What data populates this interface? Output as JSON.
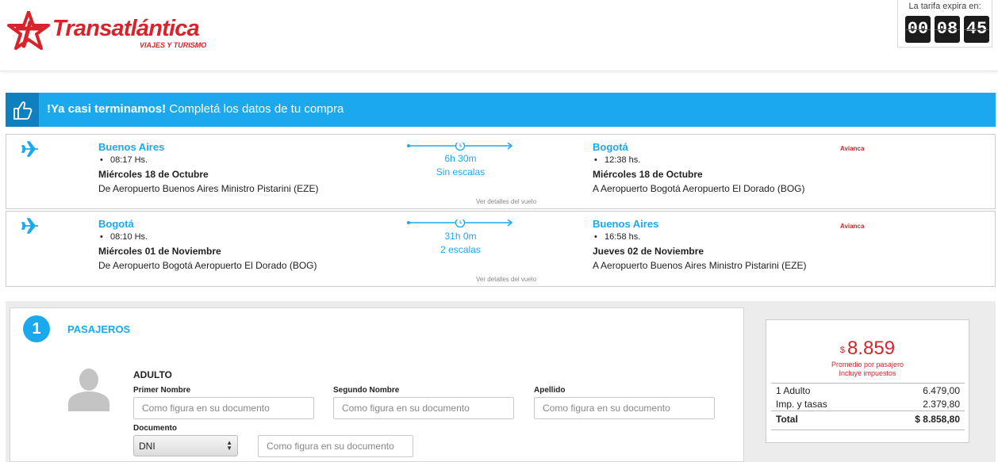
{
  "brand": {
    "name": "Transatlántica",
    "tagline": "VIAJES Y TURISMO"
  },
  "timer": {
    "label": "La tarifa expira en:",
    "hours": "00",
    "minutes": "08",
    "seconds": "45"
  },
  "banner": {
    "bold": "!Ya casi terminamos!",
    "text": "Completá los datos de tu compra"
  },
  "flights": [
    {
      "origin": {
        "city": "Buenos Aires",
        "time": "08:17 Hs.",
        "date": "Miércoles 18 de Octubre",
        "airport": "De Aeropuerto Buenos Aires Ministro Pistarini (EZE)"
      },
      "duration": "6h 30m",
      "stops": "Sin escalas",
      "destination": {
        "city": "Bogotá",
        "time": "12:38 hs.",
        "date": "Miércoles 18 de Octubre",
        "airport": "A Aeropuerto Bogotá Aeropuerto El Dorado (BOG)"
      },
      "airline": "Avianca",
      "details_link": "Ver detalles del vuelo"
    },
    {
      "origin": {
        "city": "Bogotá",
        "time": "08:10 Hs.",
        "date": "Miércoles 01 de Noviembre",
        "airport": "De Aeropuerto Bogotá Aeropuerto El Dorado (BOG)"
      },
      "duration": "31h 0m",
      "stops": "2 escalas",
      "destination": {
        "city": "Buenos Aires",
        "time": "16:58 hs.",
        "date": "Jueves 02 de Noviembre",
        "airport": "A Aeropuerto Buenos Aires Ministro Pistarini (EZE)"
      },
      "airline": "Avianca",
      "details_link": "Ver detalles del vuelo"
    }
  ],
  "passengers": {
    "step": "1",
    "title": "PASAJEROS",
    "type": "ADULTO",
    "first_name": {
      "label": "Primer Nombre",
      "placeholder": "Como figura en su documento"
    },
    "middle_name": {
      "label": "Segundo Nombre",
      "placeholder": "Como figura en su documento"
    },
    "last_name": {
      "label": "Apellido",
      "placeholder": "Como figura en su documento"
    },
    "document": {
      "label": "Documento",
      "selected": "DNI",
      "placeholder": "Como figura en su documento"
    }
  },
  "price": {
    "currency": "$",
    "amount": "8.859",
    "note1": "Promedio por pasajero",
    "note2": "Incluye impuestos",
    "rows": [
      {
        "label": "1 Adulto",
        "value": "6.479,00"
      },
      {
        "label": "Imp. y tasas",
        "value": "2.379,80"
      }
    ],
    "total_label": "Total",
    "total_value": "$ 8.858,80"
  },
  "colors": {
    "brand_red": "#d9232b",
    "accent_blue": "#1ba9ee",
    "banner_dark": "#0f7fc0"
  }
}
